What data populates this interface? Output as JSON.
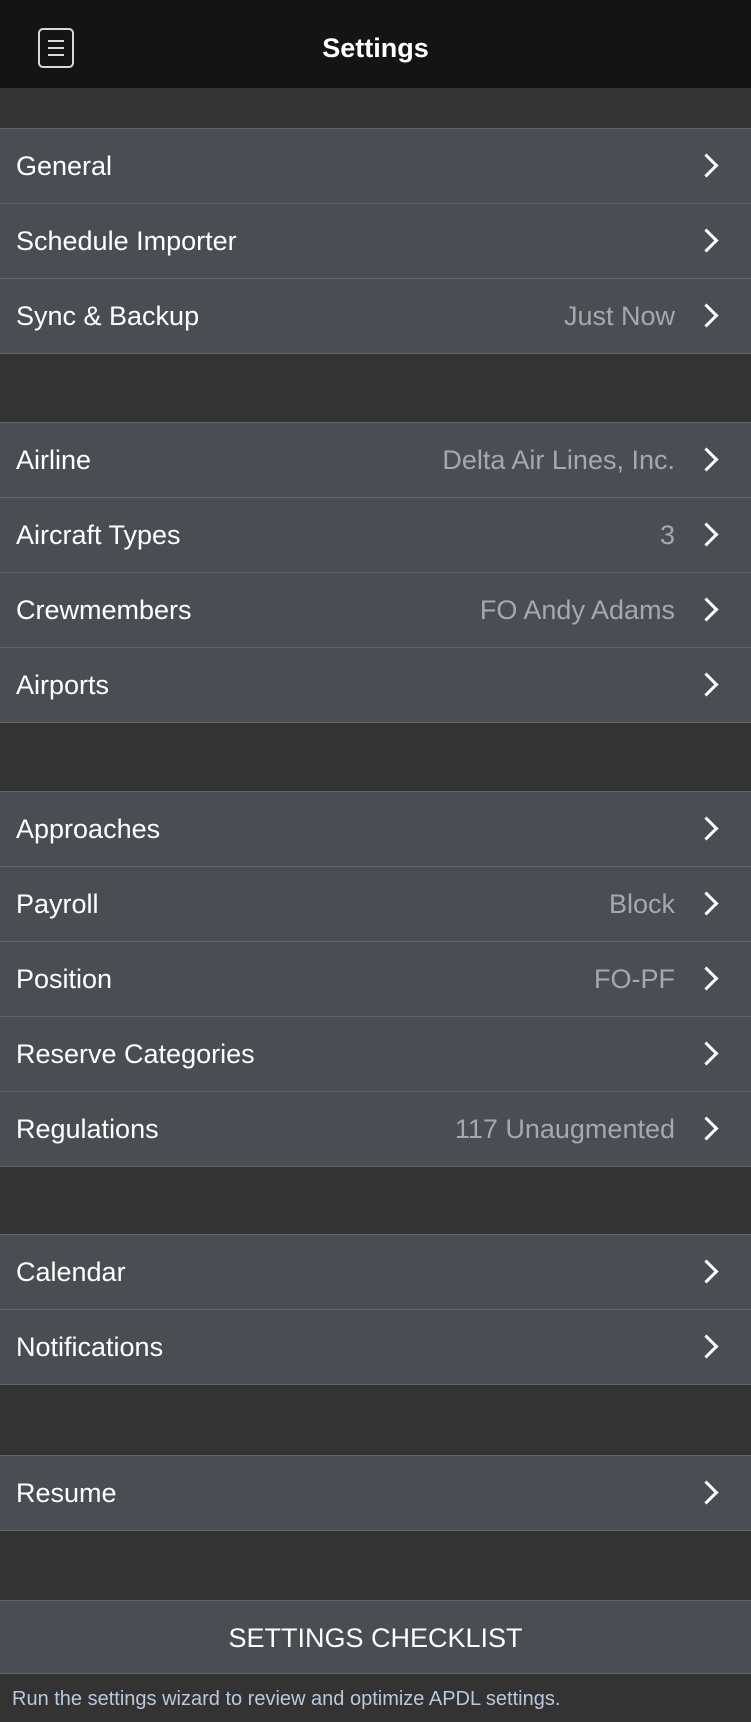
{
  "header": {
    "title": "Settings",
    "menu_icon": "menu-icon"
  },
  "groups": [
    {
      "rows": [
        {
          "label": "General",
          "value": ""
        },
        {
          "label": "Schedule Importer",
          "value": ""
        },
        {
          "label": "Sync & Backup",
          "value": "Just Now"
        }
      ]
    },
    {
      "rows": [
        {
          "label": "Airline",
          "value": "Delta Air Lines, Inc."
        },
        {
          "label": "Aircraft Types",
          "value": "3"
        },
        {
          "label": "Crewmembers",
          "value": "FO Andy Adams"
        },
        {
          "label": "Airports",
          "value": ""
        }
      ]
    },
    {
      "rows": [
        {
          "label": "Approaches",
          "value": ""
        },
        {
          "label": "Payroll",
          "value": "Block"
        },
        {
          "label": "Position",
          "value": "FO-PF"
        },
        {
          "label": "Reserve Categories",
          "value": ""
        },
        {
          "label": "Regulations",
          "value": "117 Unaugmented"
        }
      ]
    },
    {
      "rows": [
        {
          "label": "Calendar",
          "value": ""
        },
        {
          "label": "Notifications",
          "value": ""
        }
      ]
    },
    {
      "rows": [
        {
          "label": "Resume",
          "value": ""
        }
      ]
    }
  ],
  "checklist": {
    "label": "SETTINGS CHECKLIST",
    "note": "Run the settings wizard to review and optimize APDL settings."
  },
  "colors": {
    "background": "#333333",
    "navbar": "#141414",
    "row_background": "#4a4e53",
    "secondary_text": "#a5a8ac",
    "note_text": "#b8c9dc"
  }
}
